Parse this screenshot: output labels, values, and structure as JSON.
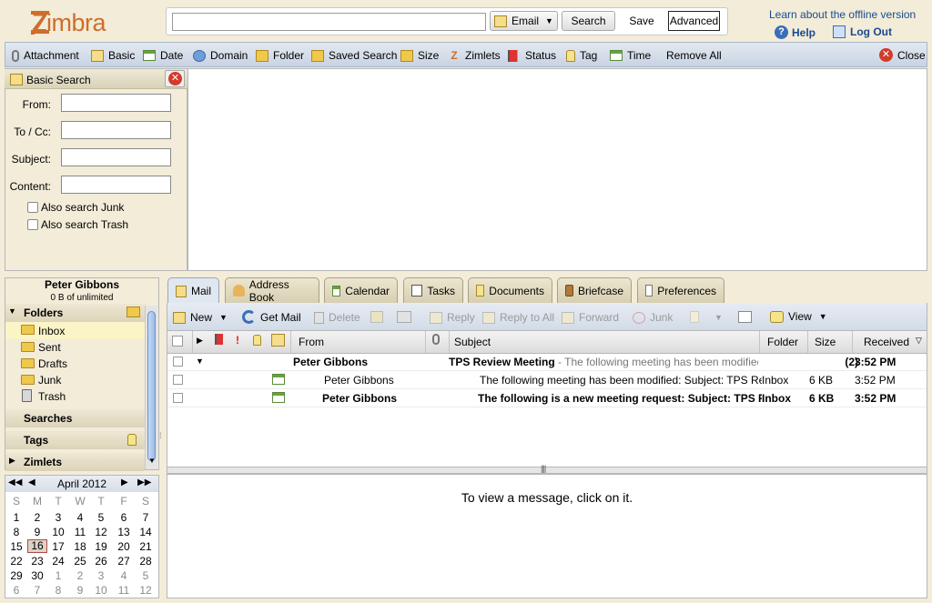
{
  "app": {
    "logo_text": "Zimbra"
  },
  "search": {
    "input_value": "",
    "type_label": "Email",
    "search_label": "Search",
    "save_label": "Save",
    "advanced_label": "Advanced"
  },
  "top_links": {
    "offline": "Learn about the offline version",
    "help": "Help",
    "logout": "Log Out"
  },
  "search_toolbar": {
    "items": [
      {
        "label": "Attachment",
        "icon": "paperclip-icon"
      },
      {
        "label": "Basic",
        "icon": "envelope-icon"
      },
      {
        "label": "Date",
        "icon": "calendar-icon"
      },
      {
        "label": "Domain",
        "icon": "domain-icon"
      },
      {
        "label": "Folder",
        "icon": "folder-icon"
      },
      {
        "label": "Saved Search",
        "icon": "saved-search-icon"
      },
      {
        "label": "Size",
        "icon": "folder-icon"
      },
      {
        "label": "Zimlets",
        "icon": "zimlet-icon"
      },
      {
        "label": "Status",
        "icon": "flag-icon"
      },
      {
        "label": "Tag",
        "icon": "tag-icon"
      },
      {
        "label": "Time",
        "icon": "calendar-icon"
      }
    ],
    "remove_all": "Remove All",
    "close": "Close"
  },
  "basic_search": {
    "title": "Basic Search",
    "fields": [
      {
        "label": "From:",
        "value": ""
      },
      {
        "label": "To / Cc:",
        "value": ""
      },
      {
        "label": "Subject:",
        "value": ""
      },
      {
        "label": "Content:",
        "value": ""
      }
    ],
    "junk_label": "Also search Junk",
    "trash_label": "Also search Trash"
  },
  "account": {
    "name": "Peter Gibbons",
    "quota": "0 B of unlimited"
  },
  "folders": {
    "header": "Folders",
    "items": [
      "Inbox",
      "Sent",
      "Drafts",
      "Junk",
      "Trash"
    ],
    "searches": "Searches",
    "tags": "Tags",
    "zimlets": "Zimlets"
  },
  "calendar": {
    "month_label": "April 2012",
    "weekdays": [
      "S",
      "M",
      "T",
      "W",
      "T",
      "F",
      "S"
    ],
    "weeks": [
      [
        "1",
        "2",
        "3",
        "4",
        "5",
        "6",
        "7"
      ],
      [
        "8",
        "9",
        "10",
        "11",
        "12",
        "13",
        "14"
      ],
      [
        "15",
        "16",
        "17",
        "18",
        "19",
        "20",
        "21"
      ],
      [
        "22",
        "23",
        "24",
        "25",
        "26",
        "27",
        "28"
      ],
      [
        "29",
        "30",
        "1",
        "2",
        "3",
        "4",
        "5"
      ],
      [
        "6",
        "7",
        "8",
        "9",
        "10",
        "11",
        "12"
      ]
    ],
    "today": "16"
  },
  "tabs": [
    "Mail",
    "Address Book",
    "Calendar",
    "Tasks",
    "Documents",
    "Briefcase",
    "Preferences"
  ],
  "mail_toolbar": {
    "new": "New",
    "get_mail": "Get Mail",
    "delete": "Delete",
    "reply": "Reply",
    "reply_all": "Reply to All",
    "forward": "Forward",
    "junk": "Junk",
    "view": "View"
  },
  "list_headers": {
    "from": "From",
    "subject": "Subject",
    "folder": "Folder",
    "size": "Size",
    "received": "Received"
  },
  "messages": [
    {
      "from": "Peter Gibbons",
      "subject": "TPS Review Meeting",
      "fragment": " - The following meeting has been modified: Su",
      "folder": "",
      "size": "(2)",
      "received": "3:52 PM"
    },
    {
      "from": "Peter Gibbons",
      "subject": "The following meeting has been modified: Subject: TPS Review",
      "fragment": "",
      "folder": "Inbox",
      "size": "6 KB",
      "received": "3:52 PM"
    },
    {
      "from": "Peter Gibbons",
      "subject": "The following is a new meeting request: Subject: TPS Re",
      "fragment": "",
      "folder": "Inbox",
      "size": "6 KB",
      "received": "3:52 PM"
    }
  ],
  "reading_pane": {
    "placeholder": "To view a message, click on it."
  },
  "colors": {
    "accent": "#cf6d2a",
    "link": "#1a4b8e",
    "toolbar": "#d2dbe7"
  }
}
